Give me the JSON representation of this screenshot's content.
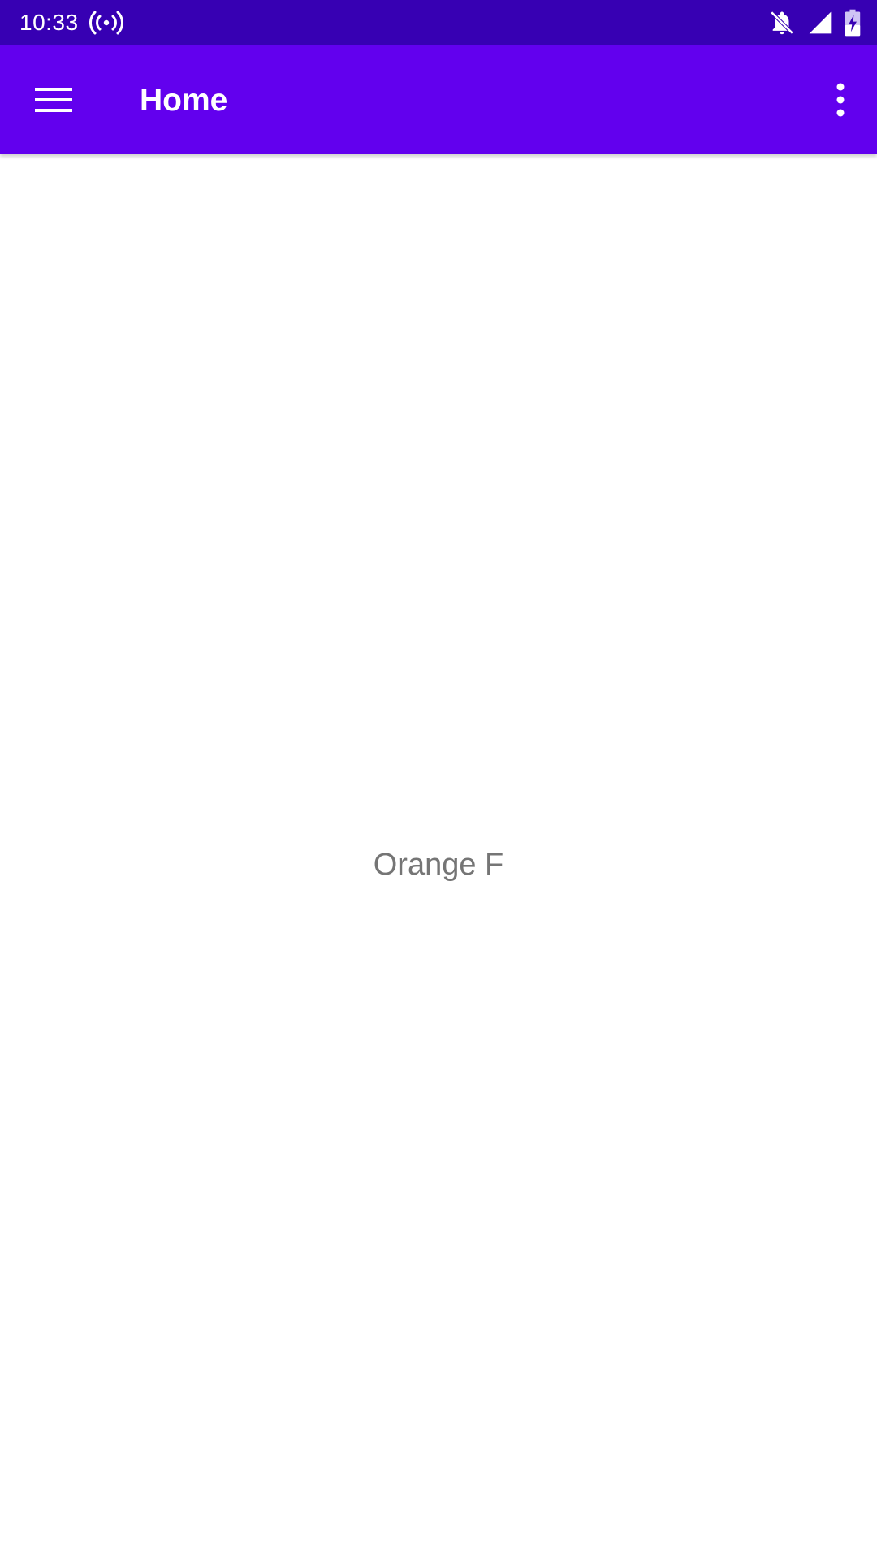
{
  "status_bar": {
    "time": "10:33",
    "icons": [
      "hotspot-icon",
      "notifications-off-icon",
      "cell-signal-icon",
      "battery-charging-icon"
    ]
  },
  "app_bar": {
    "title": "Home",
    "menu_icon": "hamburger-menu-icon",
    "overflow_icon": "more-vertical-icon"
  },
  "main": {
    "center_text": "Orange F"
  },
  "colors": {
    "status_bar": "#3700B3",
    "app_bar": "#6200EE",
    "background": "#FFFFFF",
    "center_text": "#757575"
  }
}
